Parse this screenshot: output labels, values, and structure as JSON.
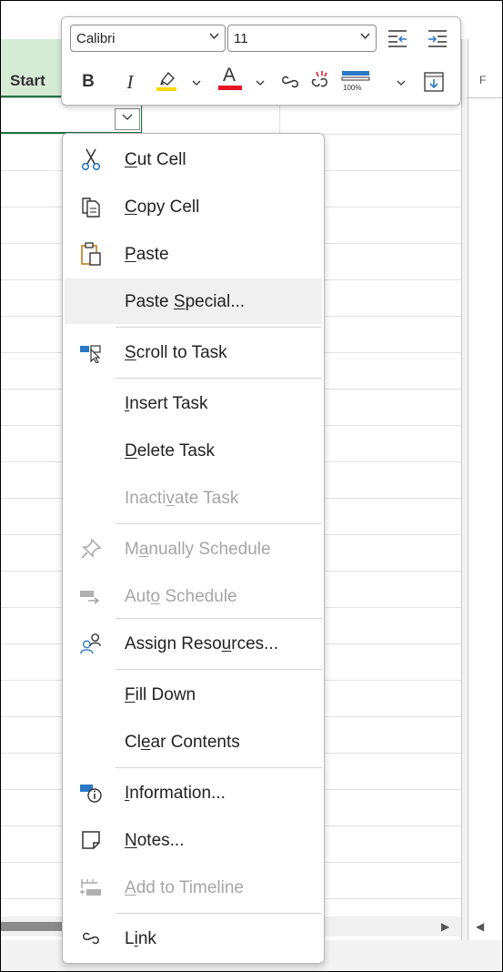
{
  "sheet": {
    "column_header_label": "Start",
    "right_column_label": "F"
  },
  "mini_toolbar": {
    "font_name": "Calibri",
    "font_size": "11",
    "buttons": {
      "bold": "B",
      "italic": "I",
      "font_color_letter": "A",
      "zoom_badge": "100%"
    }
  },
  "context_menu": {
    "items": [
      {
        "pre": "",
        "key": "C",
        "post": "ut Cell",
        "icon": "scissors-icon",
        "enabled": true
      },
      {
        "pre": "",
        "key": "C",
        "post": "opy Cell",
        "icon": "copy-icon",
        "enabled": true
      },
      {
        "pre": "",
        "key": "P",
        "post": "aste",
        "icon": "paste-icon",
        "enabled": true
      },
      {
        "pre": "Paste ",
        "key": "S",
        "post": "pecial...",
        "icon": "",
        "enabled": true
      },
      {
        "pre": "",
        "key": "S",
        "post": "croll to Task",
        "icon": "scroll-to-task-icon",
        "enabled": true
      },
      {
        "pre": "",
        "key": "I",
        "post": "nsert Task",
        "icon": "",
        "enabled": true
      },
      {
        "pre": "",
        "key": "D",
        "post": "elete Task",
        "icon": "",
        "enabled": true
      },
      {
        "pre": "Inacti",
        "key": "v",
        "post": "ate Task",
        "icon": "",
        "enabled": false
      },
      {
        "pre": "M",
        "key": "a",
        "post": "nually Schedule",
        "icon": "pin-icon",
        "enabled": false
      },
      {
        "pre": "Aut",
        "key": "o",
        "post": " Schedule",
        "icon": "auto-schedule-icon",
        "enabled": false
      },
      {
        "pre": "Assign Reso",
        "key": "u",
        "post": "rces...",
        "icon": "assign-resources-icon",
        "enabled": true
      },
      {
        "pre": "",
        "key": "F",
        "post": "ill Down",
        "icon": "",
        "enabled": true
      },
      {
        "pre": "Cl",
        "key": "e",
        "post": "ar Contents",
        "icon": "",
        "enabled": true
      },
      {
        "pre": "",
        "key": "I",
        "post": "nformation...",
        "icon": "information-icon",
        "enabled": true
      },
      {
        "pre": "",
        "key": "N",
        "post": "otes...",
        "icon": "notes-icon",
        "enabled": true
      },
      {
        "pre": "",
        "key": "A",
        "post": "dd to Timeline",
        "icon": "timeline-icon",
        "enabled": false
      },
      {
        "pre": "L",
        "key": "i",
        "post": "nk",
        "icon": "link-icon",
        "enabled": true
      }
    ]
  },
  "colors": {
    "accent_green": "#217346",
    "header_green": "#d6ebd6",
    "highlight_yellow": "#ffd700",
    "font_red": "#e81123",
    "icon_blue": "#2b78c5",
    "disabled_text": "#a6a6a6"
  }
}
